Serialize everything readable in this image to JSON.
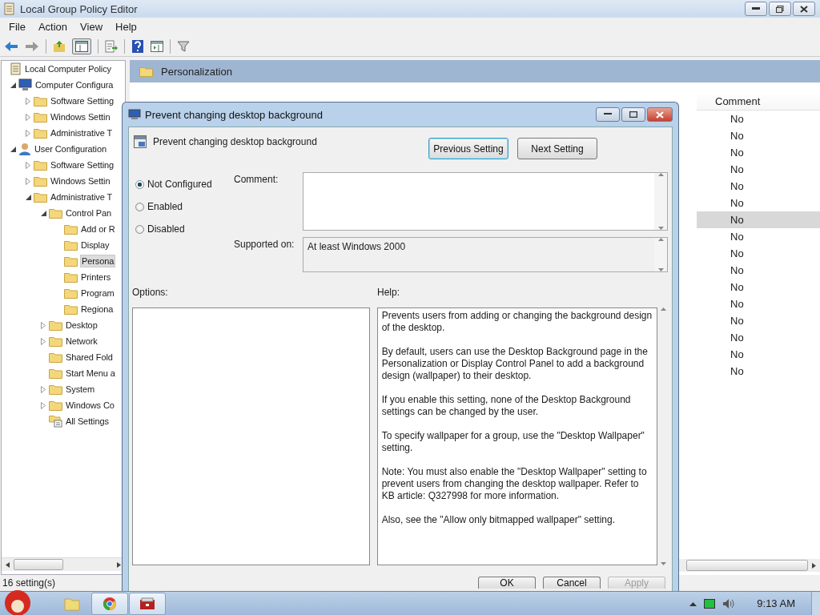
{
  "window": {
    "title": "Local Group Policy Editor"
  },
  "menu": [
    "File",
    "Action",
    "View",
    "Help"
  ],
  "tree": [
    {
      "label": "Local Computer Policy",
      "kind": "policy",
      "selected": false,
      "children": [
        {
          "label": "Computer Configura",
          "kind": "computer",
          "expanded": true,
          "selected": false,
          "children": [
            {
              "label": "Software Setting",
              "kind": "folder",
              "expanded": false,
              "selected": false
            },
            {
              "label": "Windows Settin",
              "kind": "folder",
              "expanded": false,
              "selected": false
            },
            {
              "label": "Administrative T",
              "kind": "folder",
              "expanded": false,
              "selected": false
            }
          ]
        },
        {
          "label": "User Configuration",
          "kind": "user",
          "expanded": true,
          "selected": false,
          "children": [
            {
              "label": "Software Setting",
              "kind": "folder",
              "expanded": false,
              "selected": false
            },
            {
              "label": "Windows Settin",
              "kind": "folder",
              "expanded": false,
              "selected": false
            },
            {
              "label": "Administrative T",
              "kind": "folder",
              "expanded": true,
              "selected": false,
              "children": [
                {
                  "label": "Control Pan",
                  "kind": "folder",
                  "expanded": true,
                  "selected": false,
                  "children": [
                    {
                      "label": "Add or R",
                      "kind": "folder",
                      "selected": false
                    },
                    {
                      "label": "Display",
                      "kind": "folder",
                      "selected": false
                    },
                    {
                      "label": "Persona",
                      "kind": "folder",
                      "selected": true
                    },
                    {
                      "label": "Printers",
                      "kind": "folder",
                      "selected": false
                    },
                    {
                      "label": "Program",
                      "kind": "folder",
                      "selected": false
                    },
                    {
                      "label": "Regiona",
                      "kind": "folder",
                      "selected": false
                    }
                  ]
                },
                {
                  "label": "Desktop",
                  "kind": "folder",
                  "expanded": false,
                  "selected": false
                },
                {
                  "label": "Network",
                  "kind": "folder",
                  "expanded": false,
                  "selected": false
                },
                {
                  "label": "Shared Fold",
                  "kind": "folder",
                  "selected": false
                },
                {
                  "label": "Start Menu a",
                  "kind": "folder",
                  "selected": false
                },
                {
                  "label": "System",
                  "kind": "folder",
                  "expanded": false,
                  "selected": false
                },
                {
                  "label": "Windows Co",
                  "kind": "folder",
                  "expanded": false,
                  "selected": false
                },
                {
                  "label": "All Settings",
                  "kind": "settings",
                  "selected": false
                }
              ]
            }
          ]
        }
      ]
    }
  ],
  "pane": {
    "header": "Personalization",
    "columns": [
      "Comment"
    ],
    "rows": [
      {
        "comment": "No",
        "selected": false
      },
      {
        "comment": "No",
        "selected": false
      },
      {
        "comment": "No",
        "selected": false
      },
      {
        "comment": "No",
        "selected": false
      },
      {
        "comment": "No",
        "selected": false
      },
      {
        "comment": "No",
        "selected": false
      },
      {
        "comment": "No",
        "selected": true
      },
      {
        "comment": "No",
        "selected": false
      },
      {
        "comment": "No",
        "selected": false
      },
      {
        "comment": "No",
        "selected": false
      },
      {
        "comment": "No",
        "selected": false
      },
      {
        "comment": "No",
        "selected": false
      },
      {
        "comment": "No",
        "selected": false
      },
      {
        "comment": "No",
        "selected": false
      },
      {
        "comment": "No",
        "selected": false
      },
      {
        "comment": "No",
        "selected": false
      }
    ]
  },
  "status_bar": "16 setting(s)",
  "dialog": {
    "title": "Prevent changing desktop background",
    "setting_name": "Prevent changing desktop background",
    "nav_buttons": [
      {
        "label": "Previous Setting",
        "focused": true
      },
      {
        "label": "Next Setting",
        "focused": false
      }
    ],
    "options": [
      {
        "label": "Not Configured",
        "selected": true
      },
      {
        "label": "Enabled",
        "selected": false
      },
      {
        "label": "Disabled",
        "selected": false
      }
    ],
    "comment_label": "Comment:",
    "supported_label": "Supported on:",
    "supported_value": "At least Windows 2000",
    "options_label": "Options:",
    "help_label": "Help:",
    "help": [
      "Prevents users from adding or changing the background design of the desktop.",
      "By default, users can use the Desktop Background page in the Personalization or Display Control Panel to add a background design (wallpaper) to their desktop.",
      "If you enable this setting, none of the Desktop Background settings can be changed by the user.",
      "To specify wallpaper for a group, use the \"Desktop Wallpaper\" setting.",
      "Note: You must also enable the \"Desktop Wallpaper\" setting to prevent users from changing the desktop wallpaper. Refer to KB article: Q327998 for more information.",
      "Also, see the \"Allow only bitmapped wallpaper\" setting."
    ],
    "buttons": [
      {
        "label": "OK",
        "disabled": false
      },
      {
        "label": "Cancel",
        "disabled": false
      },
      {
        "label": "Apply",
        "disabled": true
      }
    ]
  },
  "taskbar": {
    "clock": "9:13 AM"
  }
}
